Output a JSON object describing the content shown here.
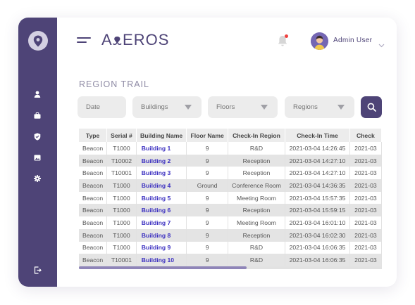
{
  "brand": {
    "name": "AᴥEROS"
  },
  "user": {
    "name": "Admin User"
  },
  "page": {
    "title": "REGION TRAIL"
  },
  "filters": {
    "date": "Date",
    "buildings": "Buildings",
    "floors": "Floors",
    "regions": "Regions"
  },
  "table": {
    "columns": [
      "Type",
      "Serial #",
      "Building Name",
      "Floor Name",
      "Check-In Region",
      "Check-In Time",
      "Check"
    ],
    "rows": [
      [
        "Beacon",
        "T1000",
        "Building 1",
        "9",
        "R&D",
        "2021-03-04 14:26:45",
        "2021-03"
      ],
      [
        "Beacon",
        "T10002",
        "Building 2",
        "9",
        "Reception",
        "2021-03-04 14:27:10",
        "2021-03"
      ],
      [
        "Beacon",
        "T10001",
        "Building 3",
        "9",
        "Reception",
        "2021-03-04 14:27:10",
        "2021-03"
      ],
      [
        "Beacon",
        "T1000",
        "Building 4",
        "Ground",
        "Conference Room",
        "2021-03-04 14:36:35",
        "2021-03"
      ],
      [
        "Beacon",
        "T1000",
        "Building 5",
        "9",
        "Meeting Room",
        "2021-03-04 15:57:35",
        "2021-03"
      ],
      [
        "Beacon",
        "T1000",
        "Building 6",
        "9",
        "Reception",
        "2021-03-04 15:59:15",
        "2021-03"
      ],
      [
        "Beacon",
        "T1000",
        "Building 7",
        "9",
        "Meeting Room",
        "2021-03-04 16:01:10",
        "2021-03"
      ],
      [
        "Beacon",
        "T1000",
        "Building 8",
        "9",
        "Reception",
        "2021-03-04 16:02:30",
        "2021-03"
      ],
      [
        "Beacon",
        "T1000",
        "Building 9",
        "9",
        "R&D",
        "2021-03-04 16:06:35",
        "2021-03"
      ],
      [
        "Beacon",
        "T10001",
        "Building 10",
        "9",
        "R&D",
        "2021-03-04 16:06:35",
        "2021-03"
      ]
    ]
  },
  "colors": {
    "accent": "#4e4477",
    "link": "#3b2fc0",
    "notification": "#f0413f"
  },
  "icons": {
    "logo": "location-pin-icon",
    "sidebar": [
      "user-icon",
      "briefcase-icon",
      "shield-icon",
      "image-icon",
      "gear-icon"
    ],
    "logout": "logout-icon"
  }
}
